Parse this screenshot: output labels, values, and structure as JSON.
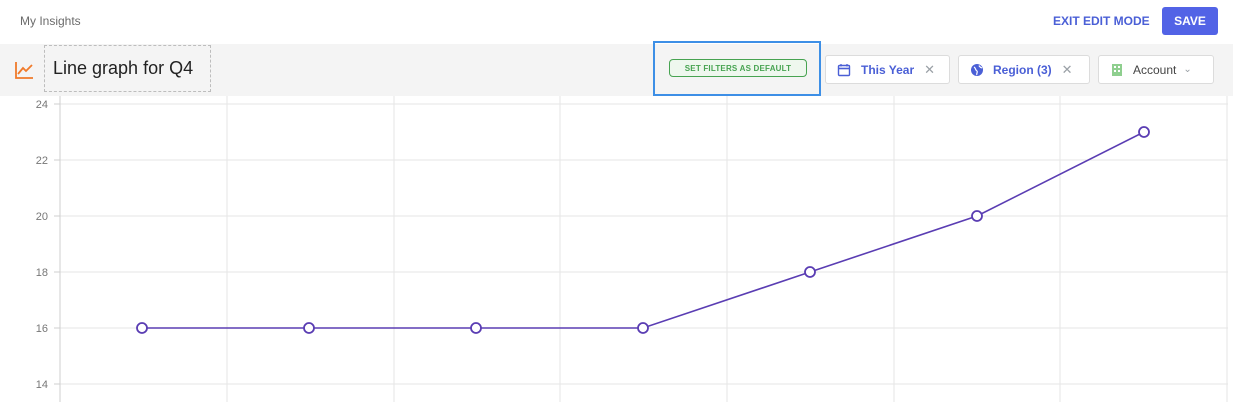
{
  "header": {
    "breadcrumb": "My Insights",
    "exit_label": "EXIT EDIT MODE",
    "save_label": "SAVE"
  },
  "toolbar": {
    "chart_icon": "line-chart-icon",
    "title": "Line graph for Q4",
    "set_default_label": "SET FILTERS AS DEFAULT",
    "filters": [
      {
        "icon": "calendar-icon",
        "label": "This Year",
        "removable": true
      },
      {
        "icon": "globe-icon",
        "label": "Region (3)",
        "removable": true
      },
      {
        "icon": "building-icon",
        "label": "Account",
        "dropdown": true
      }
    ]
  },
  "colors": {
    "accent": "#5263e6",
    "line": "#5a3db3",
    "default_green": "#47a351",
    "highlight_blue": "#3d8fe6",
    "chart_icon_orange": "#f07a2a"
  },
  "chart_data": {
    "type": "line",
    "title": "",
    "xlabel": "",
    "ylabel": "",
    "ylim": [
      13.5,
      24
    ],
    "yticks": [
      14,
      16,
      18,
      20,
      22,
      24
    ],
    "grid": true,
    "series": [
      {
        "values": [
          16,
          16,
          16,
          16,
          18,
          20,
          23
        ]
      }
    ]
  }
}
